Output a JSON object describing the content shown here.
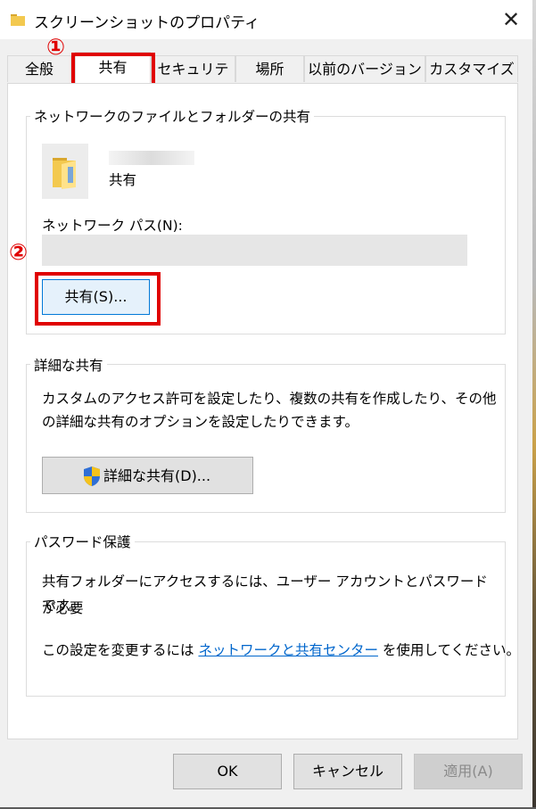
{
  "window": {
    "title": "スクリーンショットのプロパティ",
    "close_glyph": "✕"
  },
  "tabs": [
    {
      "label": "全般"
    },
    {
      "label": "共有",
      "active": true
    },
    {
      "label": "セキュリティ"
    },
    {
      "label": "場所"
    },
    {
      "label": "以前のバージョン"
    },
    {
      "label": "カスタマイズ"
    }
  ],
  "annotations": {
    "marker1": "①",
    "marker2": "②",
    "highlight_color": "#e00000"
  },
  "network_sharing": {
    "group_title": "ネットワークのファイルとフォルダーの共有",
    "folder_status": "共有",
    "network_path_label": "ネットワーク パス(N):",
    "share_button": "共有(S)..."
  },
  "advanced_sharing": {
    "group_title": "詳細な共有",
    "description_line1": "カスタムのアクセス許可を設定したり、複数の共有を作成したり、その他",
    "description_line2": "の詳細な共有のオプションを設定したりできます。",
    "button": "詳細な共有(D)...",
    "button_icon": "uac-shield-icon"
  },
  "password_protection": {
    "group_title": "パスワード保護",
    "line1": "共有フォルダーにアクセスするには、ユーザー アカウントとパスワードが必要",
    "line2": "です。",
    "change_prefix": "この設定を変更するには",
    "link": "ネットワークと共有センター",
    "change_suffix": "を使用してください。"
  },
  "footer": {
    "ok": "OK",
    "cancel": "キャンセル",
    "apply": "適用(A)"
  },
  "colors": {
    "accent_link": "#0066cc",
    "folder_yellow": "#f3c94f"
  }
}
